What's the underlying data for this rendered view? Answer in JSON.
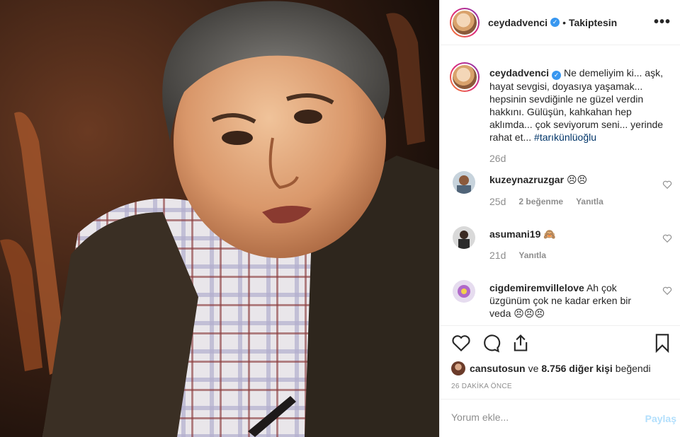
{
  "header": {
    "username": "ceydadvenci",
    "follow_status": "Takiptesin",
    "more_label": "•••"
  },
  "caption": {
    "username": "ceydadvenci",
    "text": "Ne demeliyim ki... aşk, hayat sevgisi, doyasıya yaşamak... hepsinin sevdiğinle ne güzel verdin hakkını. Gülüşün, kahkahan hep aklımda... çok seviyorum seni... yerinde rahat et...",
    "hashtag": "#tarıkünlüoğlu",
    "time": "26d"
  },
  "comments": [
    {
      "username": "kuzeynazruzgar",
      "text": "😣😣",
      "time": "25d",
      "likes": "2 beğenme",
      "reply": "Yanıtla"
    },
    {
      "username": "asumani19",
      "text": "🙈",
      "time": "21d",
      "likes": "",
      "reply": "Yanıtla"
    },
    {
      "username": "cigdemiremvillelove",
      "text": "Ah çok üzgünüm çok ne kadar erken bir veda 😣😣😣",
      "time": "",
      "likes": "",
      "reply": ""
    }
  ],
  "likes": {
    "user": "cansutosun",
    "connector": "ve",
    "others": "8.756 diğer kişi",
    "suffix": "beğendi"
  },
  "time_ago": "26 DAKİKA ÖNCE",
  "comment_box": {
    "placeholder": "Yorum ekle...",
    "post_label": "Paylaş"
  },
  "colors": {
    "verified": "#3897f0",
    "hashtag": "#003569",
    "muted": "#8e8e8e",
    "post_disabled": "#b2dffc"
  }
}
